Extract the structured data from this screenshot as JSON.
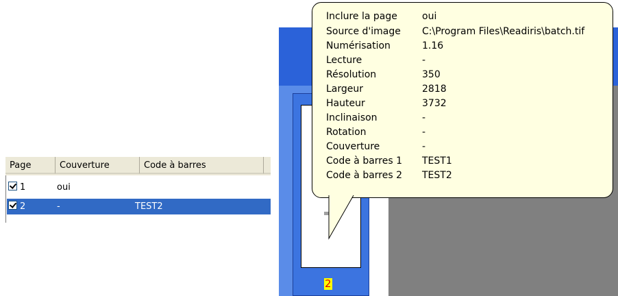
{
  "list": {
    "columns": [
      "Page",
      "Couverture",
      "Code à barres"
    ],
    "rows": [
      {
        "page": "1",
        "cover": "oui",
        "barcode": ""
      },
      {
        "page": "2",
        "cover": "-",
        "barcode": "TEST2"
      }
    ]
  },
  "thumbnail": {
    "page_number": "2"
  },
  "tooltip": {
    "rows": [
      {
        "label": "Inclure la page",
        "value": "oui"
      },
      {
        "label": "Source d'image",
        "value": "C:\\Program Files\\Readiris\\batch.tif"
      },
      {
        "label": "Numérisation",
        "value": "1.16"
      },
      {
        "label": "Lecture",
        "value": "-"
      },
      {
        "label": "Résolution",
        "value": "350"
      },
      {
        "label": "Largeur",
        "value": "2818"
      },
      {
        "label": "Hauteur",
        "value": "3732"
      },
      {
        "label": "Inclinaison",
        "value": "-"
      },
      {
        "label": "Rotation",
        "value": "-"
      },
      {
        "label": "Couverture",
        "value": "-"
      },
      {
        "label": "Code à barres 1",
        "value": "TEST1"
      },
      {
        "label": "Code à barres 2",
        "value": "TEST2"
      }
    ]
  },
  "colors": {
    "selection": "#316ac5",
    "tooltip_bg": "#ffffe1",
    "titlebar": "#2b62d9"
  }
}
